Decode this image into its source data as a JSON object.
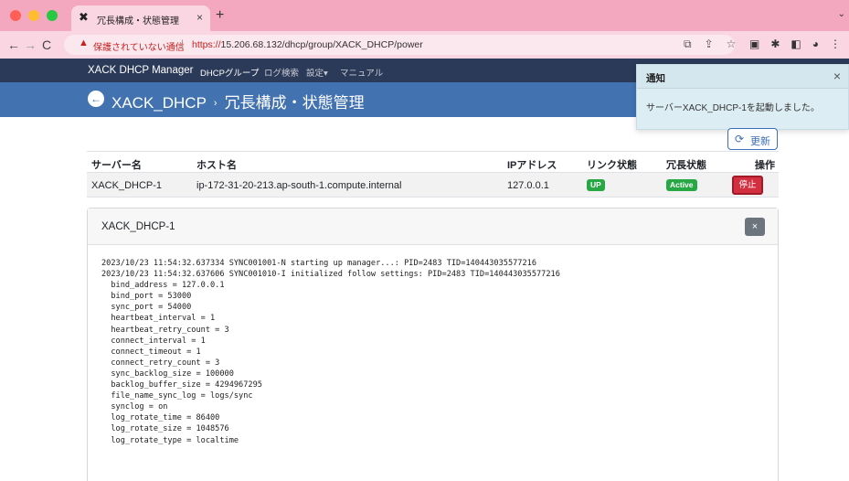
{
  "browser": {
    "tab_title": "冗長構成・状態管理",
    "tab_close": "×",
    "new_tab": "+",
    "security_warning": "保護されていない通信",
    "url_protocol": "https://",
    "url_rest": "15.206.68.132/dhcp/group/XACK_DHCP/power"
  },
  "navbar": {
    "brand": "XACK DHCP Manager",
    "links": [
      "DHCPグループ",
      "ログ検索",
      "設定▾",
      "マニュアル"
    ]
  },
  "header": {
    "title_group": "XACK_DHCP",
    "separator": "›",
    "title_page": "冗長構成・状態管理"
  },
  "toast": {
    "title": "通知",
    "close": "×",
    "message": "サーバーXACK_DHCP-1を起動しました。"
  },
  "refresh_label": "更新",
  "table": {
    "headers": [
      "サーバー名",
      "ホスト名",
      "IPアドレス",
      "リンク状態",
      "冗長状態",
      "操作"
    ],
    "rows": [
      {
        "server": "XACK_DHCP-1",
        "host": "ip-172-31-20-213.ap-south-1.compute.internal",
        "ip": "127.0.0.1",
        "link": "UP",
        "redundancy": "Active",
        "action": "停止"
      }
    ]
  },
  "log_modal": {
    "title": "XACK_DHCP-1",
    "close": "×",
    "lines": [
      "2023/10/23 11:54:32.637334 SYNC001001-N starting up manager...: PID=2483 TID=140443035577216",
      "2023/10/23 11:54:32.637606 SYNC001010-I initialized follow settings: PID=2483 TID=140443035577216",
      "  bind_address = 127.0.0.1",
      "  bind_port = 53000",
      "  sync_port = 54000",
      "  heartbeat_interval = 1",
      "  heartbeat_retry_count = 3",
      "  connect_interval = 1",
      "  connect_timeout = 1",
      "  connect_retry_count = 3",
      "  sync_backlog_size = 100000",
      "  backlog_buffer_size = 4294967295",
      "  file_name_sync_log = logs/sync",
      "  synclog = on",
      "  log_rotate_time = 86400",
      "  log_rotate_size = 1048576",
      "  log_rotate_type = localtime"
    ]
  },
  "colors": {
    "navbar": "#2b3a58",
    "header": "#4272b0",
    "badge_green": "#28a745",
    "stop_red": "#d32f3f",
    "toast_bg": "#dcedf3"
  }
}
